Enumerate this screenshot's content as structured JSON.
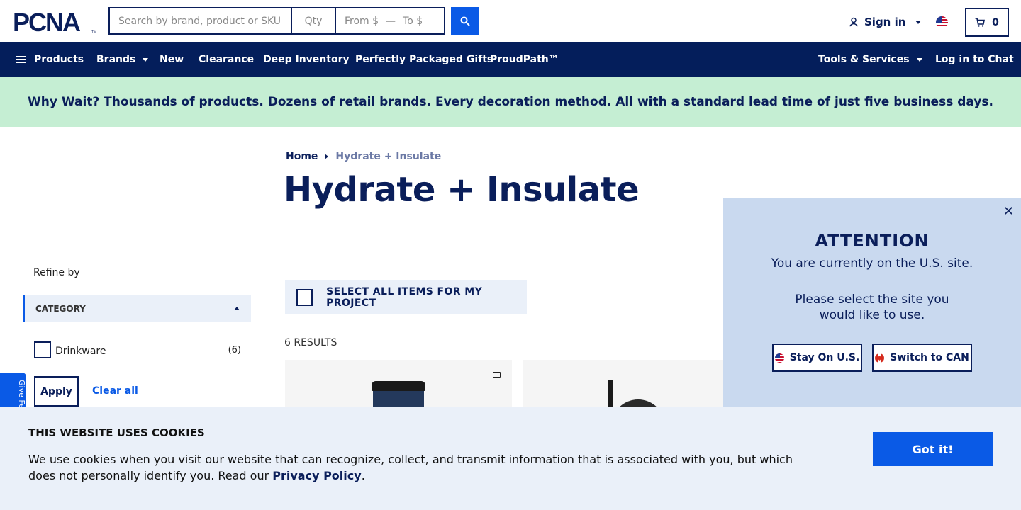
{
  "header": {
    "logo_text": "PCNA",
    "search_placeholder": "Search by brand, product or SKU",
    "qty_placeholder": "Qty",
    "price_from_placeholder": "From $",
    "price_to_placeholder": "To $",
    "signin_label": "Sign in",
    "cart_count": "0"
  },
  "nav": {
    "items": [
      "Products",
      "Brands",
      "New",
      "Clearance",
      "Deep Inventory",
      "Perfectly Packaged Gifts",
      "ProudPath™"
    ],
    "right": [
      "Tools & Services",
      "Log in to Chat"
    ]
  },
  "banner": {
    "text": "Why Wait? Thousands of products. Dozens of retail brands. Every decoration method. All with a standard lead time of just five business days."
  },
  "breadcrumb": {
    "home": "Home",
    "current": "Hydrate + Insulate"
  },
  "page_title": "Hydrate + Insulate",
  "sidebar": {
    "refine_label": "Refine by",
    "category_label": "CATEGORY",
    "filters": [
      {
        "label": "Drinkware",
        "count": "(6)"
      }
    ],
    "apply_label": "Apply",
    "clear_label": "Clear all",
    "feedback_label": "Give Fe"
  },
  "main": {
    "select_all_label": "SELECT ALL ITEMS FOR MY PROJECT",
    "results_label": "6 RESULTS"
  },
  "popup": {
    "title": "ATTENTION",
    "line1": "You are currently on the U.S. site.",
    "line2": "Please select the site you would like to use.",
    "stay_label": "Stay On U.S.",
    "switch_label": "Switch to CAN"
  },
  "cookie": {
    "title": "THIS WEBSITE USES COOKIES",
    "body": "We use cookies when you visit our website that can recognize, collect, and transmit information that is associated with you, but which does not personally identify you. Read our ",
    "link": "Privacy Policy",
    "end": ".",
    "button": "Got it!"
  },
  "colors": {
    "navy": "#041e5b",
    "accent": "#0a5ae6",
    "banner": "#c5eed3",
    "popup": "#c9d9ef"
  }
}
